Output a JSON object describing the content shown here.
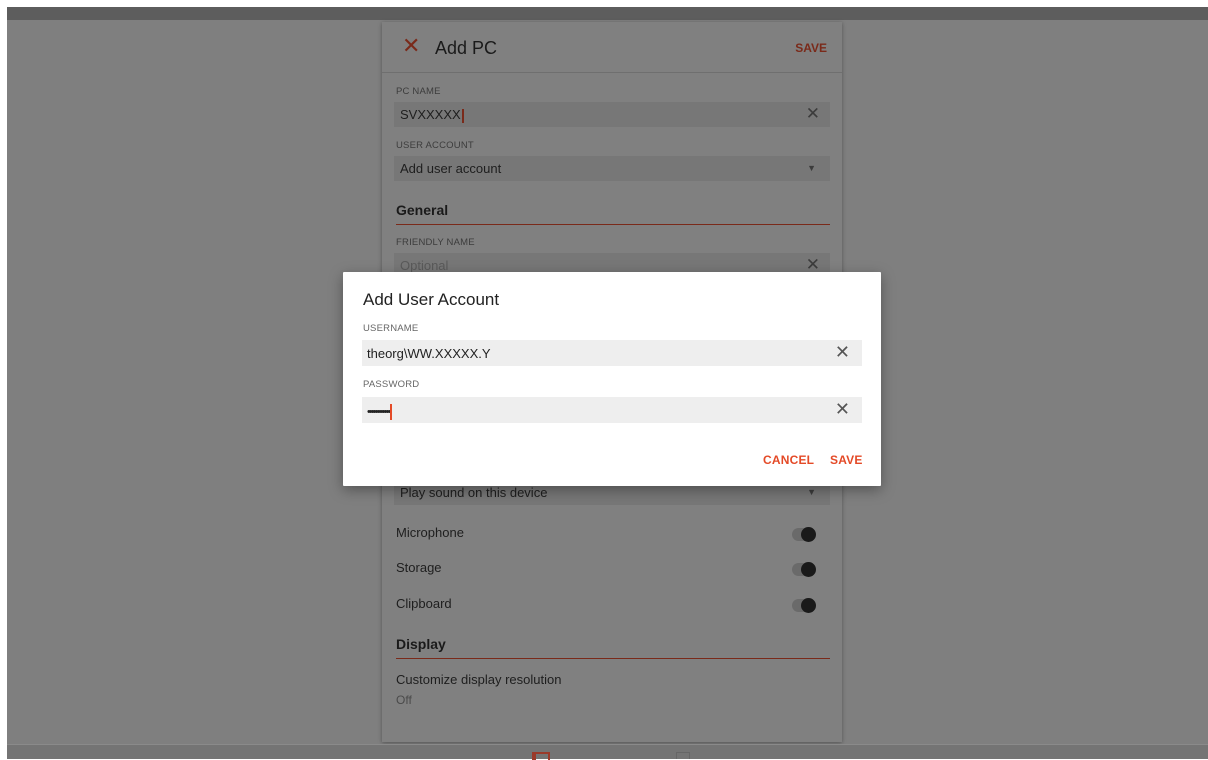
{
  "colors": {
    "accent": "#e44a27",
    "overlay": "#7f7f7f",
    "dialog_bg": "#ffffff"
  },
  "panel": {
    "title": "Add PC",
    "save_label": "SAVE",
    "close_icon": "close-icon",
    "pc_name": {
      "label": "PC NAME",
      "value": "SVXXXXX"
    },
    "user_account": {
      "label": "USER ACCOUNT",
      "value": "Add user account"
    },
    "general_section": "General",
    "friendly_name": {
      "label": "FRIENDLY NAME",
      "placeholder": "Optional"
    },
    "sound": {
      "value": "Play sound on this device"
    },
    "toggles": [
      {
        "label": "Microphone"
      },
      {
        "label": "Storage"
      },
      {
        "label": "Clipboard"
      }
    ],
    "display_section": "Display",
    "display_resolution": {
      "label": "Customize display resolution",
      "value": "Off"
    }
  },
  "dialog": {
    "title": "Add User Account",
    "username": {
      "label": "USERNAME",
      "value": "theorg\\WW.XXXXX.Y"
    },
    "password": {
      "label": "PASSWORD",
      "value": "••••••••••••"
    },
    "cancel_label": "CANCEL",
    "save_label": "SAVE"
  }
}
